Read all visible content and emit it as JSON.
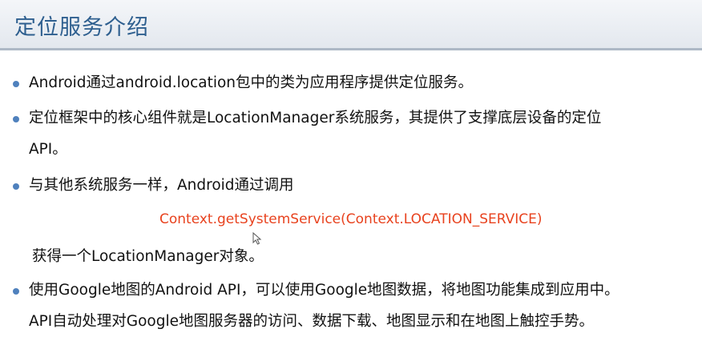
{
  "slide": {
    "title": "定位服务介绍"
  },
  "bullets": [
    {
      "lines": [
        "Android通过android.location包中的类为应用程序提供定位服务。"
      ]
    },
    {
      "lines": [
        "定位框架中的核心组件就是LocationManager系统服务，其提供了支撑底层设备的定位",
        "API。"
      ]
    },
    {
      "lines": [
        "与其他系统服务一样，Android通过调用"
      ]
    },
    {
      "lines": [
        "使用Google地图的Android API，可以使用Google地图数据，将地图功能集成到应用中。",
        "API自动处理对Google地图服务器的访问、数据下载、地图显示和在地图上触控手势。"
      ]
    }
  ],
  "code_line": "Context.getSystemService(Context.LOCATION_SERVICE)",
  "continuation": "获得一个LocationManager对象。",
  "colors": {
    "title": "#2e5f8f",
    "bullet": "#4f81bd",
    "code": "#e8421e"
  }
}
